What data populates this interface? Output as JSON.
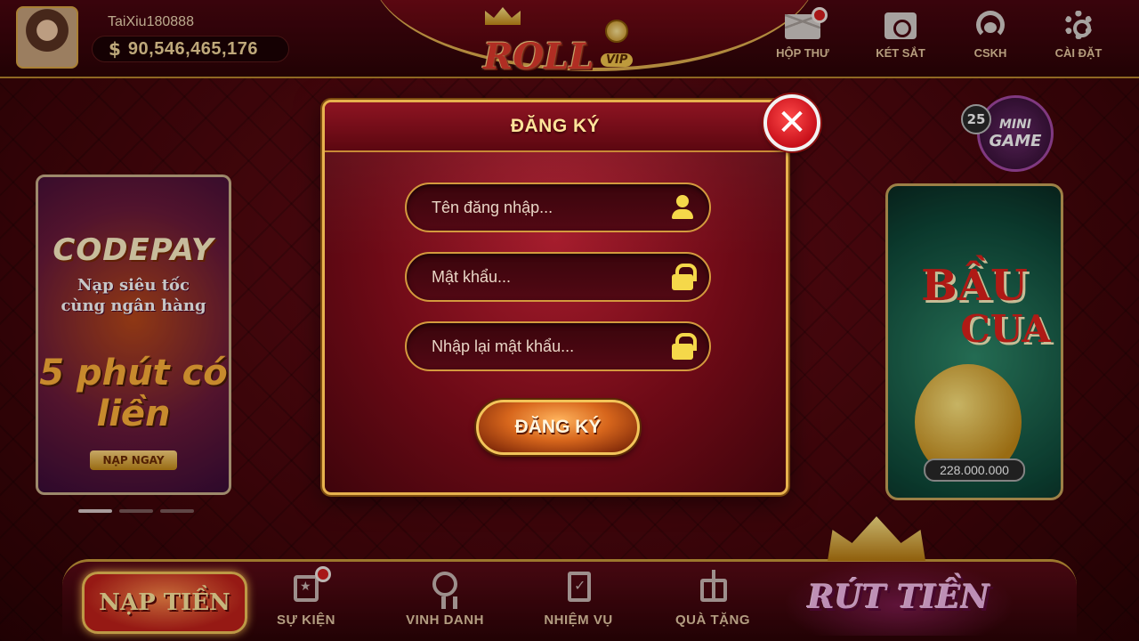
{
  "user": {
    "username": "TaiXiu180888",
    "currency_symbol": "$",
    "balance": "90,546,465,176"
  },
  "logo": {
    "text": "ROLL",
    "badge": "VIP"
  },
  "top_nav": {
    "inbox": "HỘP THƯ",
    "safe": "KÉT SẮT",
    "support": "CSKH",
    "settings": "CÀI ĐẶT"
  },
  "mini_game": {
    "count": "25",
    "line1": "MINI",
    "line2": "GAME"
  },
  "promo": {
    "title": "CODEPAY",
    "subtitle_line1": "Nạp siêu tốc",
    "subtitle_line2": "cùng ngân hàng",
    "big": "5 phút có liền",
    "button": "NẠP NGAY"
  },
  "games": {
    "baucua_word1": "BẦU",
    "baucua_word2": "CUA",
    "baucua_prize": "228.000.000"
  },
  "modal": {
    "title": "ĐĂNG KÝ",
    "close": "✕",
    "username_placeholder": "Tên đăng nhập...",
    "password_placeholder": "Mật khẩu...",
    "confirm_placeholder": "Nhập lại mật khẩu...",
    "submit": "ĐĂNG KÝ"
  },
  "bottom_nav": {
    "deposit": "NẠP TIỀN",
    "events": "SỰ KIỆN",
    "honors": "VINH DANH",
    "missions": "NHIỆM VỤ",
    "gifts": "QUÀ TẶNG",
    "withdraw": "RÚT TIỀN"
  },
  "colors": {
    "gold": "#e7b24e",
    "crimson": "#6d0a16",
    "icon_yellow": "#f5d84a"
  }
}
